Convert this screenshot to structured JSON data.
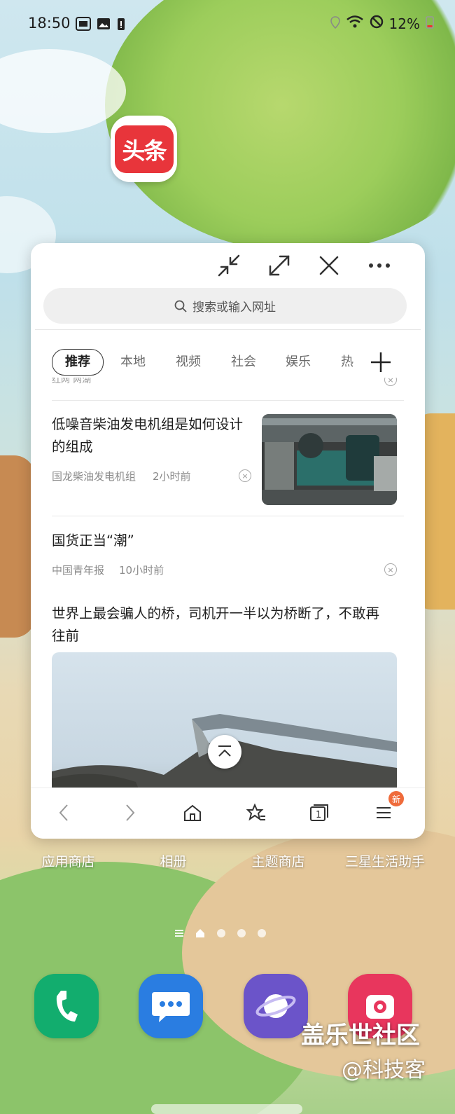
{
  "status_bar": {
    "time": "18:50",
    "battery_percent": "12%"
  },
  "floating_app": {
    "name": "头条"
  },
  "popup": {
    "address_placeholder": "搜索或输入网址",
    "tabs": [
      "推荐",
      "本地",
      "视频",
      "社会",
      "娱乐",
      "热"
    ],
    "cut_item_meta": "红网 两湖",
    "articles": [
      {
        "title_line1": "低噪音柴油发电机组是如何设计",
        "title_line2": "的组成",
        "source": "国龙柴油发电机组",
        "time": "2小时前"
      },
      {
        "title_line1": "国货正当“潮”",
        "source": "中国青年报",
        "time": "10小时前"
      },
      {
        "title_line1": "世界上最会骗人的桥，司机开一半以为桥断了，不敢再",
        "title_line2": "往前"
      }
    ],
    "nav_badge": "新"
  },
  "home_apps": [
    "应用商店",
    "相册",
    "主题商店",
    "三星生活助手"
  ],
  "watermark": {
    "line1": "盖乐世社区",
    "line2": "@科技客"
  },
  "colors": {
    "accent_red": "#e8353b",
    "badge_orange": "#ef6b3b",
    "phone_green": "#12ad6e",
    "messages_blue": "#2a7de1",
    "internet_purple": "#6b54c9",
    "camera_pink": "#e8365d"
  }
}
